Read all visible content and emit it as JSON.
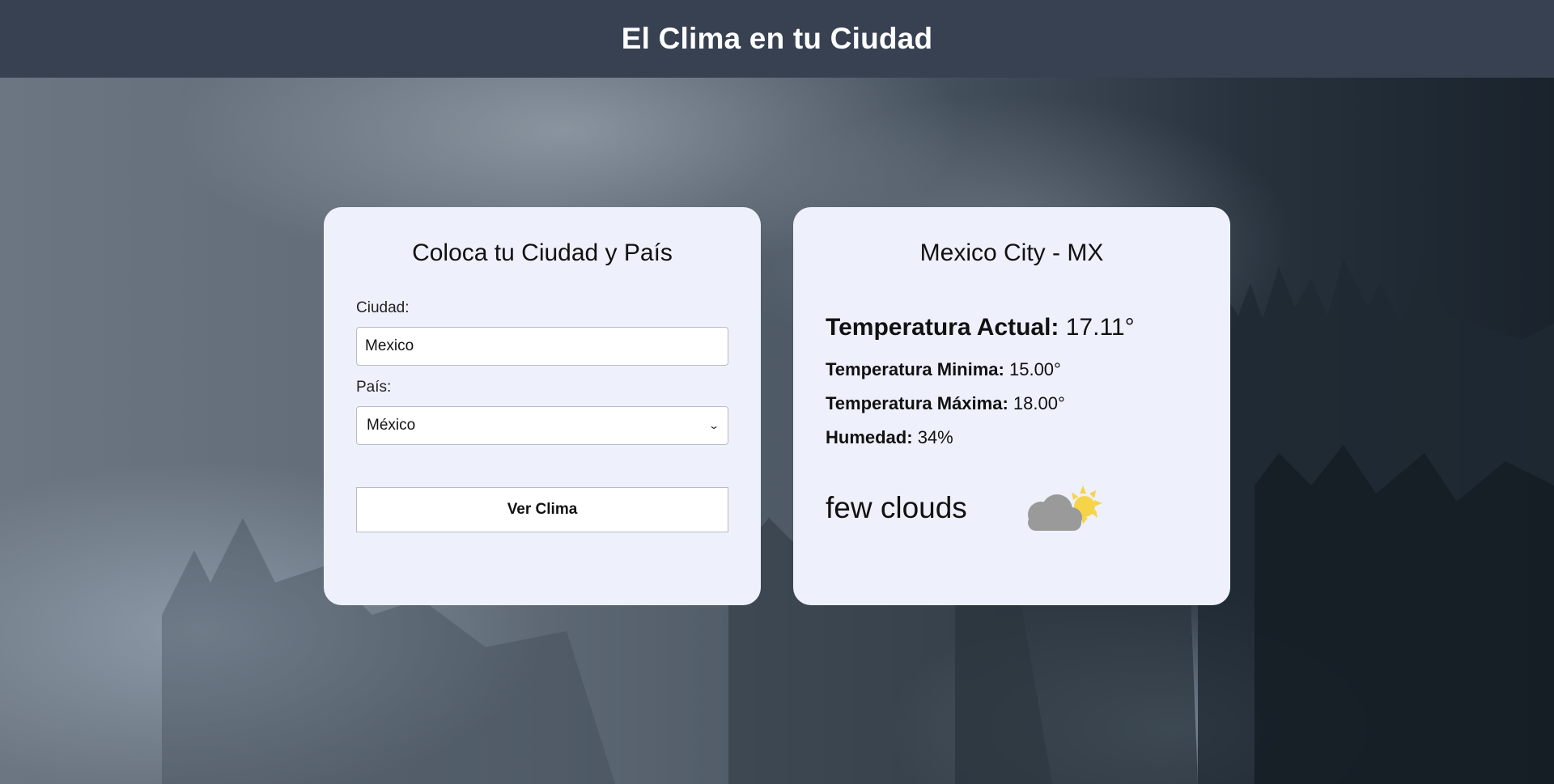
{
  "header": {
    "title": "El Clima en tu Ciudad"
  },
  "form": {
    "title": "Coloca tu Ciudad y País",
    "city_label": "Ciudad:",
    "city_value": "Mexico",
    "country_label": "País:",
    "country_value": "México",
    "submit_label": "Ver Clima"
  },
  "result": {
    "location": "Mexico City - MX",
    "current_label": "Temperatura Actual:",
    "current_value": "17.11°",
    "min_label": "Temperatura Minima:",
    "min_value": "15.00°",
    "max_label": "Temperatura Máxima:",
    "max_value": "18.00°",
    "humidity_label": "Humedad:",
    "humidity_value": "34%",
    "description": "few clouds",
    "icon": "few-clouds-icon"
  },
  "colors": {
    "header_bg": "#374151",
    "card_bg": "#eef1fc",
    "cloud": "#9a9a9a",
    "sun": "#f6d44a"
  }
}
